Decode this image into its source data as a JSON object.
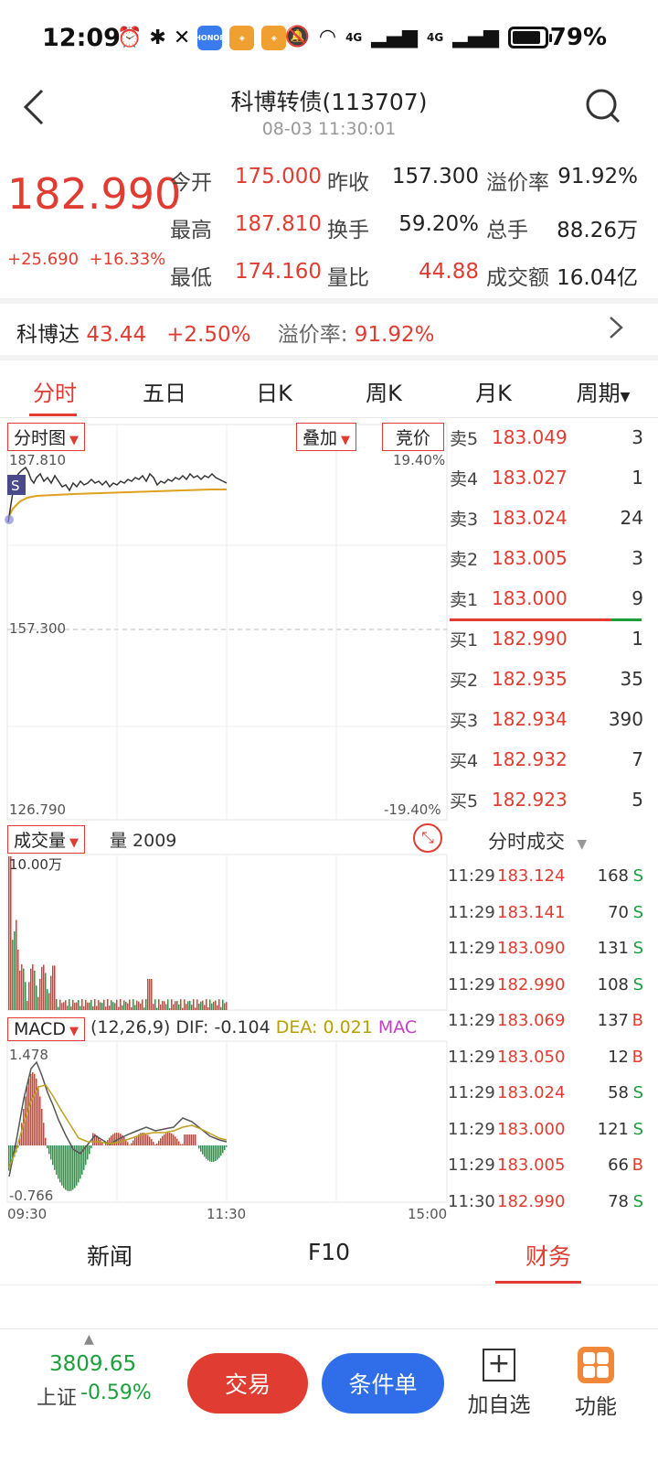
{
  "status_bar": {
    "time": "12:09",
    "battery": "79%",
    "net1": "4G",
    "net2": "4G",
    "brand_badge": "HONOR"
  },
  "header": {
    "title": "科博转债(113707)",
    "subtitle": "08-03 11:30:01"
  },
  "quote": {
    "price": "182.990",
    "change": "+25.690",
    "change_pct": "+16.33%",
    "rows": [
      [
        {
          "label": "今开",
          "value": "175.000",
          "color": "red"
        },
        {
          "label": "昨收",
          "value": "157.300",
          "color": "black"
        },
        {
          "label": "溢价率",
          "value": "91.92%",
          "color": "black"
        }
      ],
      [
        {
          "label": "最高",
          "value": "187.810",
          "color": "red"
        },
        {
          "label": "换手",
          "value": "59.20%",
          "color": "black"
        },
        {
          "label": "总手",
          "value": "88.26万",
          "color": "black"
        }
      ],
      [
        {
          "label": "最低",
          "value": "174.160",
          "color": "red"
        },
        {
          "label": "量比",
          "value": "44.88",
          "color": "red"
        },
        {
          "label": "成交额",
          "value": "16.04亿",
          "color": "black"
        }
      ]
    ]
  },
  "underlying": {
    "name": "科博达",
    "price": "43.44",
    "change_pct": "+2.50%",
    "premium_label": "溢价率:",
    "premium": "91.92%"
  },
  "tabs": [
    "分时",
    "五日",
    "日K",
    "周K",
    "月K",
    "周期"
  ],
  "chart": {
    "chip_main": "分时图",
    "chip_overlay": "叠加",
    "chip_auction": "竞价",
    "y_top": "187.810",
    "y_mid": "157.300",
    "y_bot": "126.790",
    "pct_top": "19.40%",
    "pct_bot": "-19.40%",
    "marker_s": "S",
    "vol_chip": "成交量",
    "vol_label": "量 2009",
    "vol_max": "10.00万",
    "macd_chip": "MACD",
    "macd_params": "(12,26,9)",
    "dif": "DIF: -0.104",
    "dea": "DEA: 0.021",
    "mac": "MAC",
    "macd_top": "1.478",
    "macd_bot": "-0.766",
    "x_start": "09:30",
    "x_mid": "11:30",
    "x_end": "15:00"
  },
  "orderbook": [
    {
      "label": "卖5",
      "price": "183.049",
      "vol": "3"
    },
    {
      "label": "卖4",
      "price": "183.027",
      "vol": "1"
    },
    {
      "label": "卖3",
      "price": "183.024",
      "vol": "24"
    },
    {
      "label": "卖2",
      "price": "183.005",
      "vol": "3"
    },
    {
      "label": "卖1",
      "price": "183.000",
      "vol": "9"
    },
    {
      "label": "买1",
      "price": "182.990",
      "vol": "1"
    },
    {
      "label": "买2",
      "price": "182.935",
      "vol": "35"
    },
    {
      "label": "买3",
      "price": "182.934",
      "vol": "390"
    },
    {
      "label": "买4",
      "price": "182.932",
      "vol": "7"
    },
    {
      "label": "买5",
      "price": "182.923",
      "vol": "5"
    }
  ],
  "ticks_title": "分时成交",
  "ticks": [
    {
      "time": "11:29",
      "price": "183.124",
      "vol": "168",
      "side": "S"
    },
    {
      "time": "11:29",
      "price": "183.141",
      "vol": "70",
      "side": "S"
    },
    {
      "time": "11:29",
      "price": "183.090",
      "vol": "131",
      "side": "S"
    },
    {
      "time": "11:29",
      "price": "182.990",
      "vol": "108",
      "side": "S"
    },
    {
      "time": "11:29",
      "price": "183.069",
      "vol": "137",
      "side": "B"
    },
    {
      "time": "11:29",
      "price": "183.050",
      "vol": "12",
      "side": "B"
    },
    {
      "time": "11:29",
      "price": "183.024",
      "vol": "58",
      "side": "S"
    },
    {
      "time": "11:29",
      "price": "183.000",
      "vol": "121",
      "side": "S"
    },
    {
      "time": "11:29",
      "price": "183.005",
      "vol": "66",
      "side": "B"
    },
    {
      "time": "11:30",
      "price": "182.990",
      "vol": "78",
      "side": "S"
    }
  ],
  "bottom_tabs": [
    "新闻",
    "F10",
    "财务"
  ],
  "footer": {
    "index_value": "3809.65",
    "index_name": "上证",
    "index_change": "-0.59%",
    "trade": "交易",
    "conditional": "条件单",
    "add_watch": "加自选",
    "functions": "功能"
  },
  "colors": {
    "up": "#e03c31",
    "down": "#1a9f3c",
    "accent_blue": "#2f6ee8",
    "orange": "#f0883a"
  }
}
